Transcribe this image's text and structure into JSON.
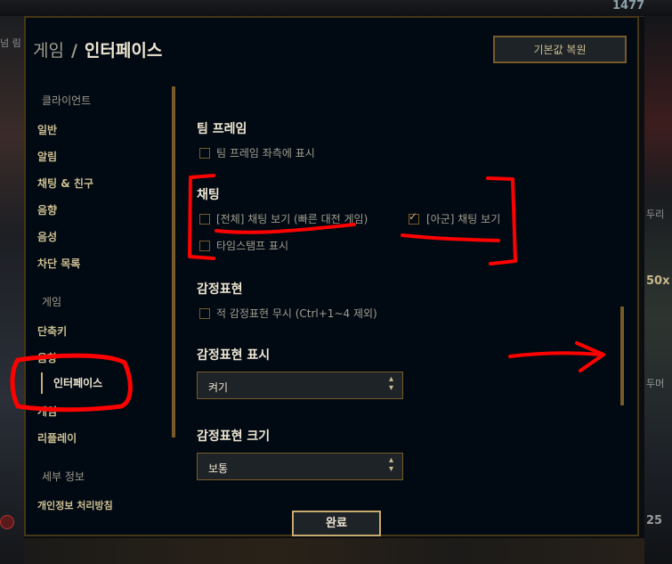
{
  "background": {
    "top_currency": "1477",
    "left_label": "넘 림",
    "right_labels": [
      "두리",
      "50x",
      "두머",
      "25"
    ]
  },
  "dialog": {
    "breadcrumb_parent": "게임",
    "breadcrumb_separator": "/",
    "title": "인터페이스",
    "reset_button": "기본값 복원",
    "done_button": "완료"
  },
  "sidebar": {
    "client_header": "클라이언트",
    "client_items": [
      "일반",
      "알림",
      "채팅 & 친구",
      "음향",
      "음성",
      "차단 목록"
    ],
    "game_header": "게임",
    "game_items": [
      "단축키",
      "음향",
      "인터페이스",
      "게임",
      "리플레이"
    ],
    "active_item": "인터페이스",
    "info_header": "세부 정보",
    "info_items": [
      "개인정보 처리방침"
    ]
  },
  "settings": {
    "team_frame": {
      "title": "팀 프레임",
      "options": [
        {
          "label": "팀 프레임 좌측에 표시",
          "checked": false
        }
      ]
    },
    "chat": {
      "title": "채팅",
      "options": [
        {
          "label": "[전체] 채팅 보기 (빠른 대전 게임)",
          "checked": false
        },
        {
          "label": "[아군] 채팅 보기",
          "checked": true
        },
        {
          "label": "타임스탬프 표시",
          "checked": false
        }
      ]
    },
    "emotes": {
      "title": "감정표현",
      "options": [
        {
          "label": "적 감정표현 무시 (Ctrl+1~4 제외)",
          "checked": false
        }
      ]
    },
    "emote_display": {
      "title": "감정표현 표시",
      "value": "켜기"
    },
    "emote_size": {
      "title": "감정표현 크기",
      "value": "보통"
    }
  },
  "colors": {
    "gold": "#c8aa6e",
    "border": "#785a28",
    "panel": "#010a13",
    "annotation_red": "#ff0000"
  }
}
